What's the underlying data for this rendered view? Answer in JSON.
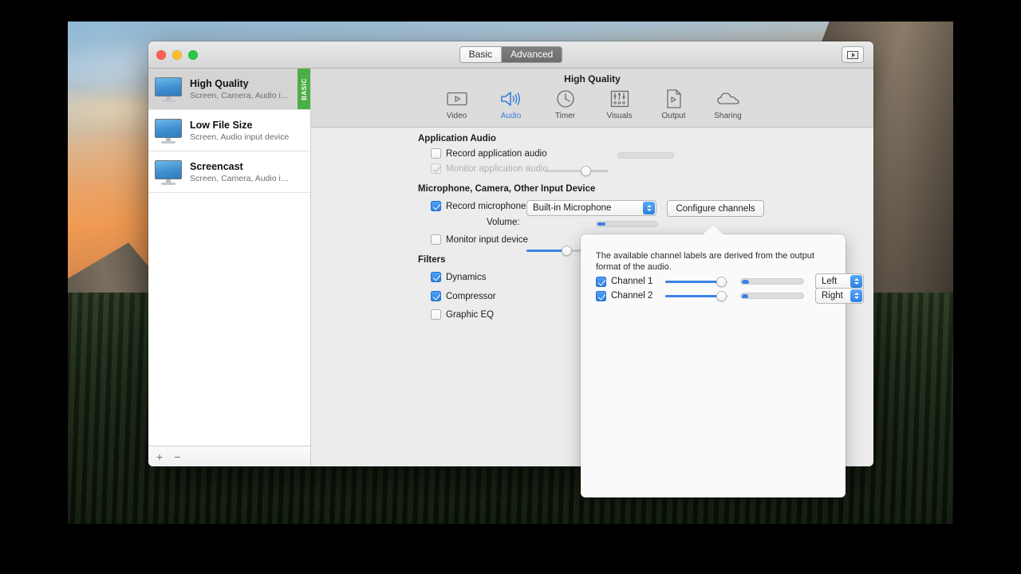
{
  "window": {
    "traffic_lights": [
      "close",
      "minimize",
      "zoom"
    ],
    "mode_tabs": [
      {
        "label": "Basic",
        "active": false
      },
      {
        "label": "Advanced",
        "active": true
      }
    ],
    "record_button": "record-button"
  },
  "sidebar": {
    "presets": [
      {
        "title": "High Quality",
        "subtitle": "Screen, Camera, Audio inpu...",
        "selected": true,
        "badge": "BASIC"
      },
      {
        "title": "Low File Size",
        "subtitle": "Screen, Audio input device",
        "selected": false,
        "badge": ""
      },
      {
        "title": "Screencast",
        "subtitle": "Screen, Camera, Audio inpu...",
        "selected": false,
        "badge": ""
      }
    ],
    "footer": {
      "add_label": "+",
      "remove_label": "−"
    }
  },
  "toolbar": {
    "preset_title": "High Quality",
    "items": [
      {
        "label": "Video",
        "icon": "video-icon",
        "active": false
      },
      {
        "label": "Audio",
        "icon": "audio-icon",
        "active": true
      },
      {
        "label": "Timer",
        "icon": "timer-icon",
        "active": false
      },
      {
        "label": "Visuals",
        "icon": "visuals-icon",
        "active": false
      },
      {
        "label": "Output",
        "icon": "output-icon",
        "active": false
      },
      {
        "label": "Sharing",
        "icon": "sharing-icon",
        "active": false
      }
    ],
    "accent_color": "#3b7fd6"
  },
  "panel": {
    "application_audio": {
      "heading": "Application Audio",
      "record_label": "Record application audio",
      "record_checked": false,
      "record_slider_value": 62,
      "record_meter_value": 0,
      "monitor_label": "Monitor application audio",
      "monitor_checked": true,
      "monitor_enabled": false
    },
    "input_device": {
      "heading": "Microphone, Camera, Other Input Device",
      "record_label": "Record microphone",
      "record_checked": true,
      "device_value": "Built-in Microphone",
      "configure_button": "Configure channels",
      "volume_label": "Volume:",
      "volume_value": 62,
      "volume_meter_value": 13,
      "monitor_label": "Monitor input device",
      "monitor_checked": false
    },
    "filters": {
      "heading": "Filters",
      "items": [
        {
          "label": "Dynamics",
          "checked": true
        },
        {
          "label": "Compressor",
          "checked": true
        },
        {
          "label": "Graphic EQ",
          "checked": false
        }
      ]
    }
  },
  "popover": {
    "description": "The available channel labels are derived from the output format of the audio.",
    "channels": [
      {
        "label": "Channel 1",
        "checked": true,
        "gain": 80,
        "meter": 12,
        "assignment": "Left"
      },
      {
        "label": "Channel 2",
        "checked": true,
        "gain": 80,
        "meter": 10,
        "assignment": "Right"
      }
    ]
  }
}
